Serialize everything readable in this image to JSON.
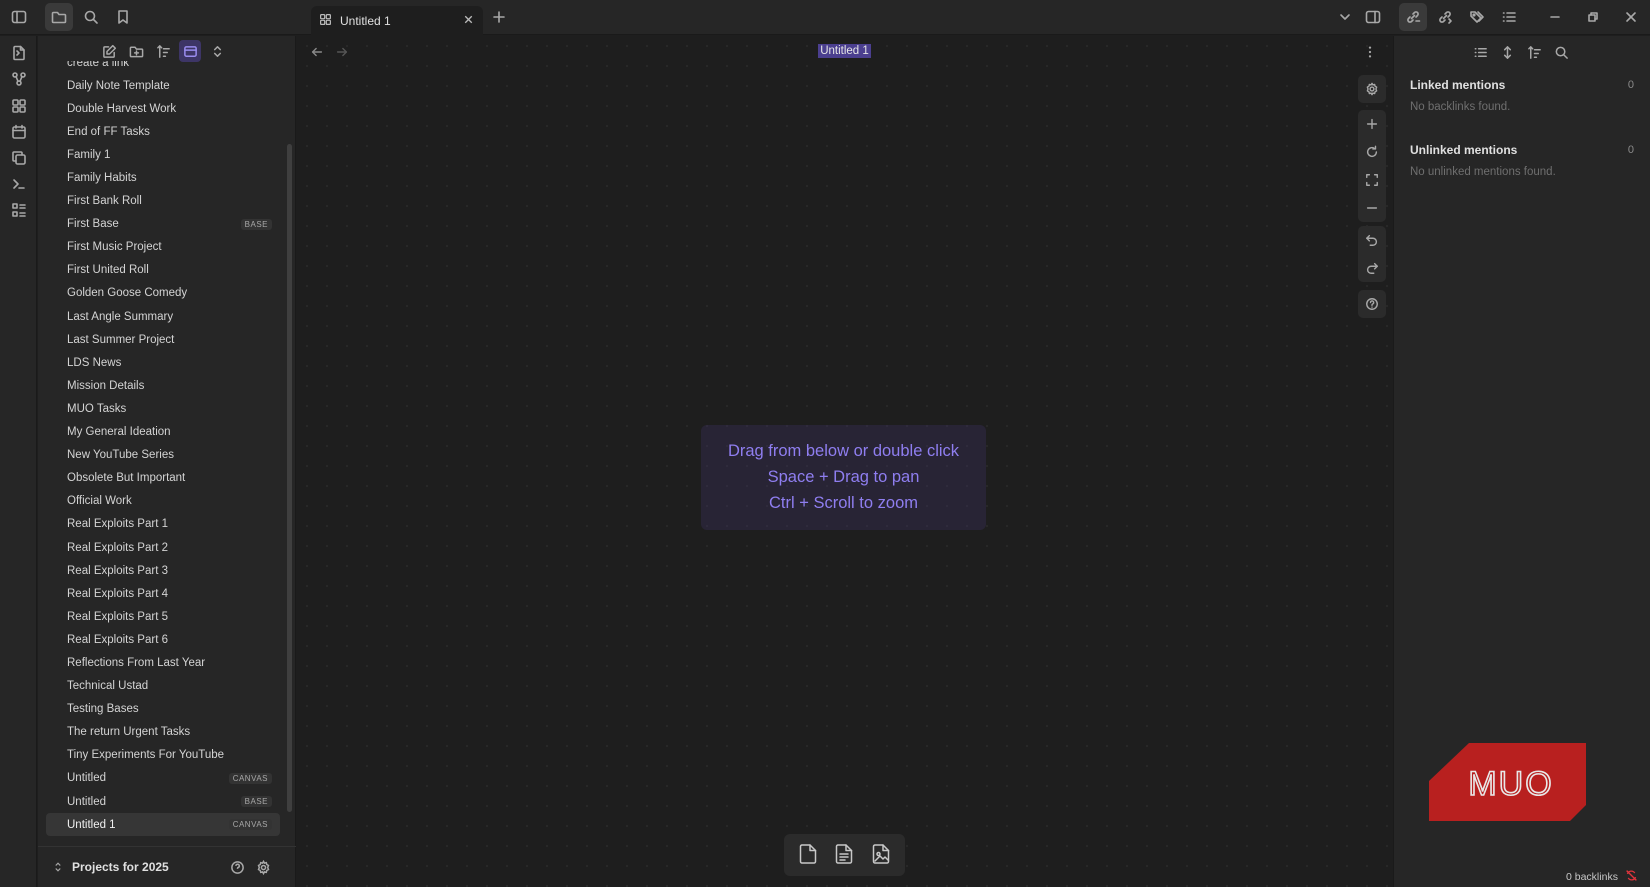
{
  "tab": {
    "title": "Untitled 1"
  },
  "view": {
    "title": "Untitled 1"
  },
  "files": [
    {
      "name": "create a link",
      "badge": ""
    },
    {
      "name": "Daily Note Template",
      "badge": ""
    },
    {
      "name": "Double Harvest Work",
      "badge": ""
    },
    {
      "name": "End of FF Tasks",
      "badge": ""
    },
    {
      "name": "Family 1",
      "badge": ""
    },
    {
      "name": "Family Habits",
      "badge": ""
    },
    {
      "name": "First Bank Roll",
      "badge": ""
    },
    {
      "name": "First Base",
      "badge": "BASE"
    },
    {
      "name": "First Music Project",
      "badge": ""
    },
    {
      "name": "First United Roll",
      "badge": ""
    },
    {
      "name": "Golden Goose Comedy",
      "badge": ""
    },
    {
      "name": "Last Angle Summary",
      "badge": ""
    },
    {
      "name": "Last Summer Project",
      "badge": ""
    },
    {
      "name": "LDS News",
      "badge": ""
    },
    {
      "name": "Mission Details",
      "badge": ""
    },
    {
      "name": "MUO Tasks",
      "badge": ""
    },
    {
      "name": "My General Ideation",
      "badge": ""
    },
    {
      "name": "New YouTube Series",
      "badge": ""
    },
    {
      "name": "Obsolete But Important",
      "badge": ""
    },
    {
      "name": "Official Work",
      "badge": ""
    },
    {
      "name": "Real Exploits Part 1",
      "badge": ""
    },
    {
      "name": "Real Exploits Part 2",
      "badge": ""
    },
    {
      "name": "Real Exploits Part 3",
      "badge": ""
    },
    {
      "name": "Real Exploits Part 4",
      "badge": ""
    },
    {
      "name": "Real Exploits Part 5",
      "badge": ""
    },
    {
      "name": "Real Exploits Part 6",
      "badge": ""
    },
    {
      "name": "Reflections From Last Year",
      "badge": ""
    },
    {
      "name": "Technical Ustad",
      "badge": ""
    },
    {
      "name": "Testing Bases",
      "badge": ""
    },
    {
      "name": "The return Urgent Tasks",
      "badge": ""
    },
    {
      "name": "Tiny Experiments For YouTube",
      "badge": ""
    },
    {
      "name": "Untitled",
      "badge": "CANVAS"
    },
    {
      "name": "Untitled",
      "badge": "BASE"
    },
    {
      "name": "Untitled 1",
      "badge": "CANVAS",
      "selected": true
    }
  ],
  "vault": {
    "name": "Projects for 2025"
  },
  "canvas": {
    "hint_lines": [
      "Drag from below or double click",
      "Space + Drag to pan",
      "Ctrl + Scroll to zoom"
    ]
  },
  "backlinks": {
    "linked_title": "Linked mentions",
    "linked_count": "0",
    "linked_empty": "No backlinks found.",
    "unlinked_title": "Unlinked mentions",
    "unlinked_count": "0",
    "unlinked_empty": "No unlinked mentions found."
  },
  "status": {
    "backlinks": "0 backlinks"
  },
  "logo": {
    "text": "MUO"
  },
  "colors": {
    "accent": "#8f7ef0",
    "logo_red": "#b8201f",
    "sync_error": "#e0343c"
  }
}
